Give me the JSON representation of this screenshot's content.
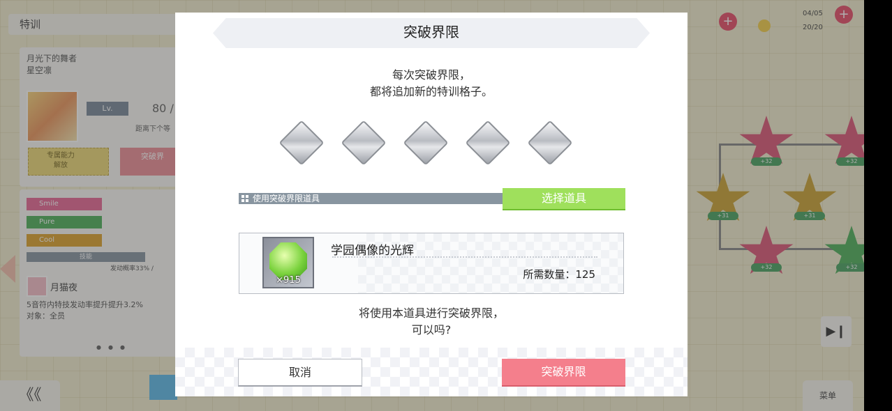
{
  "background": {
    "screen_title": "特训",
    "card": {
      "name_line1": "月光下的舞者",
      "name_line2": "星空凛",
      "level_label": "Lv.",
      "level_value": "80 /",
      "level_sub": "距离下个等",
      "gold_button_text": "专属能力\n解放",
      "pink_button_text": "突破界"
    },
    "stats": [
      {
        "label": "Smile",
        "color": "#e35a8a"
      },
      {
        "label": "Pure",
        "color": "#3ea84b"
      },
      {
        "label": "Cool",
        "color": "#d99a1b"
      }
    ],
    "stat_grey_label": "技能",
    "stat_line": "发动概率33% /",
    "skill_name": "月猫夜",
    "skill_desc_line1": "5音符内特技发动率提升提升3.2%",
    "skill_desc_line2": "对象：全员",
    "back_button": "《《",
    "menu_button": "菜单",
    "star_labels": [
      "+32",
      "+32",
      "+31",
      "+31",
      "+32",
      "+32"
    ],
    "resource_lines": [
      "04/05",
      "20/20"
    ]
  },
  "dialog": {
    "title": "突破界限",
    "message_line1": "每次突破界限，",
    "message_line2": "都将追加新的特训格子。",
    "use_item_label": "使用突破界限道具",
    "select_item_button": "选择道具",
    "item": {
      "name": "学园偶像的光辉",
      "quantity": "×915",
      "required_label": "所需数量：125"
    },
    "confirm_line1": "将使用本道具进行突破界限，",
    "confirm_line2": "可以吗?",
    "cancel_button": "取消",
    "confirm_button": "突破界限"
  }
}
